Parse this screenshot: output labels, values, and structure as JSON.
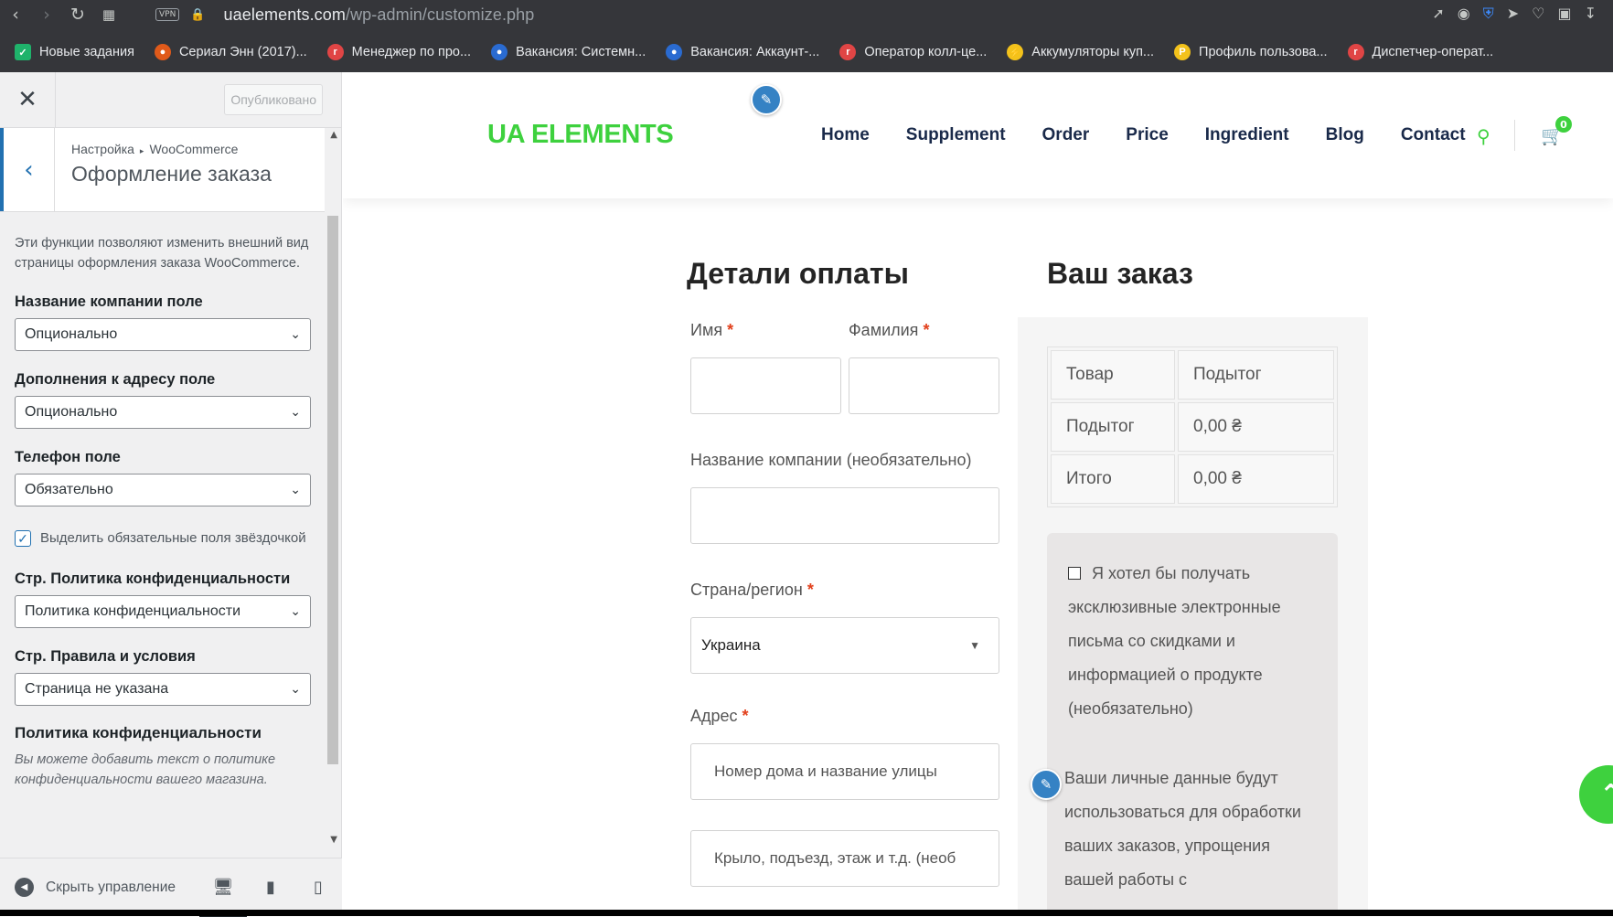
{
  "browser": {
    "url_host": "uaelements.com",
    "url_path": "/wp-admin/customize.php",
    "vpn_label": "VPN",
    "bookmarks": [
      {
        "label": "Новые задания",
        "color": "#1fb36b",
        "icon": "check-icon"
      },
      {
        "label": "Сериал Энн (2017)...",
        "color": "#e05a1a",
        "icon": "flame-icon"
      },
      {
        "label": "Менеджер по про...",
        "color": "#e04545",
        "icon": "r-icon"
      },
      {
        "label": "Вакансия: Системн...",
        "color": "#2a6bd1",
        "icon": "target-icon"
      },
      {
        "label": "Вакансия: Аккаунт-...",
        "color": "#2a6bd1",
        "icon": "target-icon"
      },
      {
        "label": "Оператор колл-це...",
        "color": "#e04545",
        "icon": "r-icon"
      },
      {
        "label": "Аккумуляторы куп...",
        "color": "#f3c21b",
        "icon": "bolt-icon"
      },
      {
        "label": "Профиль пользова...",
        "color": "#f3c21b",
        "icon": "p-icon"
      },
      {
        "label": "Диспетчер-операт...",
        "color": "#e04545",
        "icon": "r-icon"
      }
    ]
  },
  "customizer": {
    "publish_label": "Опубликовано",
    "breadcrumb_root": "Настройка",
    "breadcrumb_section": "WooCommerce",
    "section_title": "Оформление заказа",
    "description": "Эти функции позволяют изменить внешний вид страницы оформления заказа WooCommerce.",
    "controls": [
      {
        "label": "Название компании поле",
        "value": "Опционально"
      },
      {
        "label": "Дополнения к адресу поле",
        "value": "Опционально"
      },
      {
        "label": "Телефон поле",
        "value": "Обязательно"
      }
    ],
    "highlight_required_label": "Выделить обязательные поля звёздочкой",
    "privacy_page_label": "Стр. Политика конфиденциальности",
    "privacy_page_value": "Политика конфиденциальности",
    "terms_page_label": "Стр. Правила и условия",
    "terms_page_value": "Страница не указана",
    "privacy_policy_title": "Политика конфиденциальности",
    "privacy_policy_desc": "Вы можете добавить текст о политике конфиденциальности вашего магазина.",
    "hide_controls_label": "Скрыть управление"
  },
  "site": {
    "logo": "UA ELEMENTS",
    "menu": [
      "Home",
      "Supplement",
      "Order",
      "Price",
      "Ingredient",
      "Blog",
      "Contact"
    ],
    "cart_count": "0",
    "accent_color": "#3ed13e"
  },
  "checkout": {
    "billing_title": "Детали оплаты",
    "first_name_label": "Имя",
    "last_name_label": "Фамилия",
    "company_label": "Название компании (необязательно)",
    "country_label": "Страна/регион",
    "country_value": "Украина",
    "address_label": "Адрес",
    "address_placeholder_1": "Номер дома и название улицы",
    "address_placeholder_2": "Крыло, подъезд, этаж и т.д. (необ",
    "required_mark": "*"
  },
  "order": {
    "title": "Ваш заказ",
    "rows": [
      [
        "Товар",
        "Подытог"
      ],
      [
        "Подытог",
        "0,00 ₴"
      ],
      [
        "Итого",
        "0,00 ₴"
      ]
    ],
    "newsletter_text": "Я хотел бы получать эксклюзивные электронные письма со скидками и информацией о продукте (необязательно)",
    "privacy_text": "Ваши личные данные будут использоваться для обработки ваших заказов, упрощения вашей работы с"
  }
}
